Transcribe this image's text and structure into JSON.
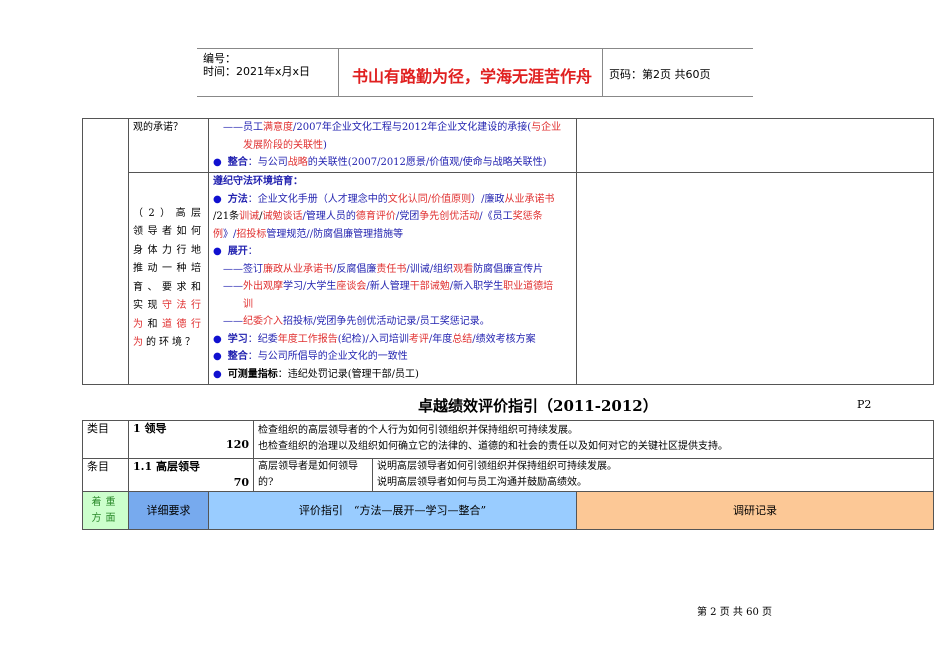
{
  "header": {
    "number_label": "编号：",
    "date_label": "时间：2021年x月x日",
    "motto": "书山有路勤为径，学海无涯苦作舟",
    "page_label": "页码：第2页  共60页"
  },
  "colors": {
    "blue": "#2323b0",
    "red": "#e03030",
    "green_cell": "#ccffcc",
    "blue_cell": "#99ccff",
    "light_blue_cell": "#99ccff",
    "orange_cell": "#fcc896"
  },
  "top_table": {
    "row1": {
      "question": "观的承诺？",
      "lines": [
        {
          "indent": 1,
          "segs": [
            [
              "——员工",
              "b"
            ],
            [
              "满意度",
              "r"
            ],
            [
              "/2007年企业文化工程与2012年企业文化建设的承接(",
              "b"
            ],
            [
              "与企业",
              "r"
            ]
          ]
        },
        {
          "indent": 2,
          "segs": [
            [
              "发展阶段的关联性",
              "r"
            ],
            [
              ")",
              "b"
            ]
          ]
        },
        {
          "bullet": true,
          "segs": [
            [
              "整合",
              "bb"
            ],
            [
              "：与公司",
              "b"
            ],
            [
              "战略",
              "r"
            ],
            [
              "的关联性(2007/2012愿景/价值观/使命与战略关联性)",
              "b"
            ]
          ]
        }
      ]
    },
    "row2": {
      "question_segs": [
        [
          "（2）高层领导者如何身体力行地推动一种培育、要求和实现",
          "k"
        ],
        [
          "守法行为",
          "r"
        ],
        [
          "和",
          "k"
        ],
        [
          "道德行为",
          "r"
        ],
        [
          "的环境？",
          "k"
        ]
      ],
      "lines": [
        {
          "segs": [
            [
              "遵纪守法环境培育：",
              "bb"
            ]
          ]
        },
        {
          "bullet": true,
          "segs": [
            [
              "方法",
              "bb"
            ],
            [
              "：企业文化手册（人才理念中的",
              "b"
            ],
            [
              "文化认同/价值原则",
              "r"
            ],
            [
              "）/廉政",
              "b"
            ],
            [
              "从业承诺书",
              "r"
            ]
          ]
        },
        {
          "segs": [
            [
              "/21条",
              "k"
            ],
            [
              "训诫",
              "r"
            ],
            [
              "/",
              "k"
            ],
            [
              "诫勉谈话",
              "r"
            ],
            [
              "/管理人员的",
              "b"
            ],
            [
              "德育评价",
              "r"
            ],
            [
              "/党团",
              "b"
            ],
            [
              "争先创优活动",
              "r"
            ],
            [
              "/《员工",
              "b"
            ],
            [
              "奖惩条",
              "r"
            ]
          ]
        },
        {
          "segs": [
            [
              "例",
              "r"
            ],
            [
              "》/",
              "b"
            ],
            [
              "招投标",
              "r"
            ],
            [
              "管理规范//防腐倡廉管理措施等",
              "b"
            ]
          ]
        },
        {
          "bullet": true,
          "segs": [
            [
              "展开",
              "bb"
            ],
            [
              "：",
              "b"
            ]
          ]
        },
        {
          "indent": 1,
          "segs": [
            [
              "——签订",
              "b"
            ],
            [
              "廉政从业承诺书",
              "r"
            ],
            [
              "/反腐倡廉",
              "b"
            ],
            [
              "责任书",
              "r"
            ],
            [
              "/训诫/组织",
              "b"
            ],
            [
              "观看",
              "r"
            ],
            [
              "防腐倡廉宣传片",
              "b"
            ]
          ]
        },
        {
          "indent": 1,
          "segs": [
            [
              "——",
              "b"
            ],
            [
              "外出观摩",
              "r"
            ],
            [
              "学习/大学生",
              "b"
            ],
            [
              "座谈会",
              "r"
            ],
            [
              "/新人管理",
              "b"
            ],
            [
              "干部诫勉",
              "r"
            ],
            [
              "/新入职学生",
              "b"
            ],
            [
              "职业道德培",
              "r"
            ]
          ]
        },
        {
          "indent": 2,
          "segs": [
            [
              "训",
              "r"
            ]
          ]
        },
        {
          "indent": 1,
          "segs": [
            [
              "——",
              "b"
            ],
            [
              "纪委介入",
              "r"
            ],
            [
              "招投标/党团争先创优活动记录/员工奖惩记录。",
              "b"
            ]
          ]
        },
        {
          "bullet": true,
          "segs": [
            [
              "学习",
              "bb"
            ],
            [
              "：纪委",
              "b"
            ],
            [
              "年度工作报告",
              "r"
            ],
            [
              "(纪检)/入司培训",
              "b"
            ],
            [
              "考评",
              "r"
            ],
            [
              "/年度",
              "b"
            ],
            [
              "总结",
              "r"
            ],
            [
              "/绩效考核方案",
              "b"
            ]
          ]
        },
        {
          "bullet": true,
          "segs": [
            [
              "整合",
              "bb"
            ],
            [
              "：与公司所倡导的企业文化的一致性",
              "b"
            ]
          ]
        },
        {
          "bullet": true,
          "segs": [
            [
              "可测量指标",
              "kb"
            ],
            [
              "：违纪处罚记录(管理干部/员工)",
              "k"
            ]
          ]
        }
      ]
    }
  },
  "section_title": "卓越绩效评价指引（2011-2012）",
  "page_tag": "P2",
  "bottom_table": {
    "category_label": "类目",
    "category_name": "1 领导",
    "category_score": "120",
    "category_desc": [
      "检查组织的高层领导者的个人行为如何引领组织并保持组织可持续发展。",
      "也检查组织的治理以及组织如何确立它的法律的、道德的和社会的责任以及如何对它的关键社区提供支持。"
    ],
    "item_label": "条目",
    "item_name": "1.1 高层领导",
    "item_score": "70",
    "item_question": "高层领导者是如何领导的?",
    "item_desc": [
      "说明高层领导者如何引领组织并保持组织可持续发展。",
      "说明高层领导者如何与员工沟通并鼓励高绩效。"
    ],
    "focus_label": "着重方面",
    "detail_label": "详细要求",
    "guide_label": "评价指引　“方法—展开—学习—整合”",
    "record_label": "调研记录"
  },
  "footer": "第 2 页 共 60 页"
}
